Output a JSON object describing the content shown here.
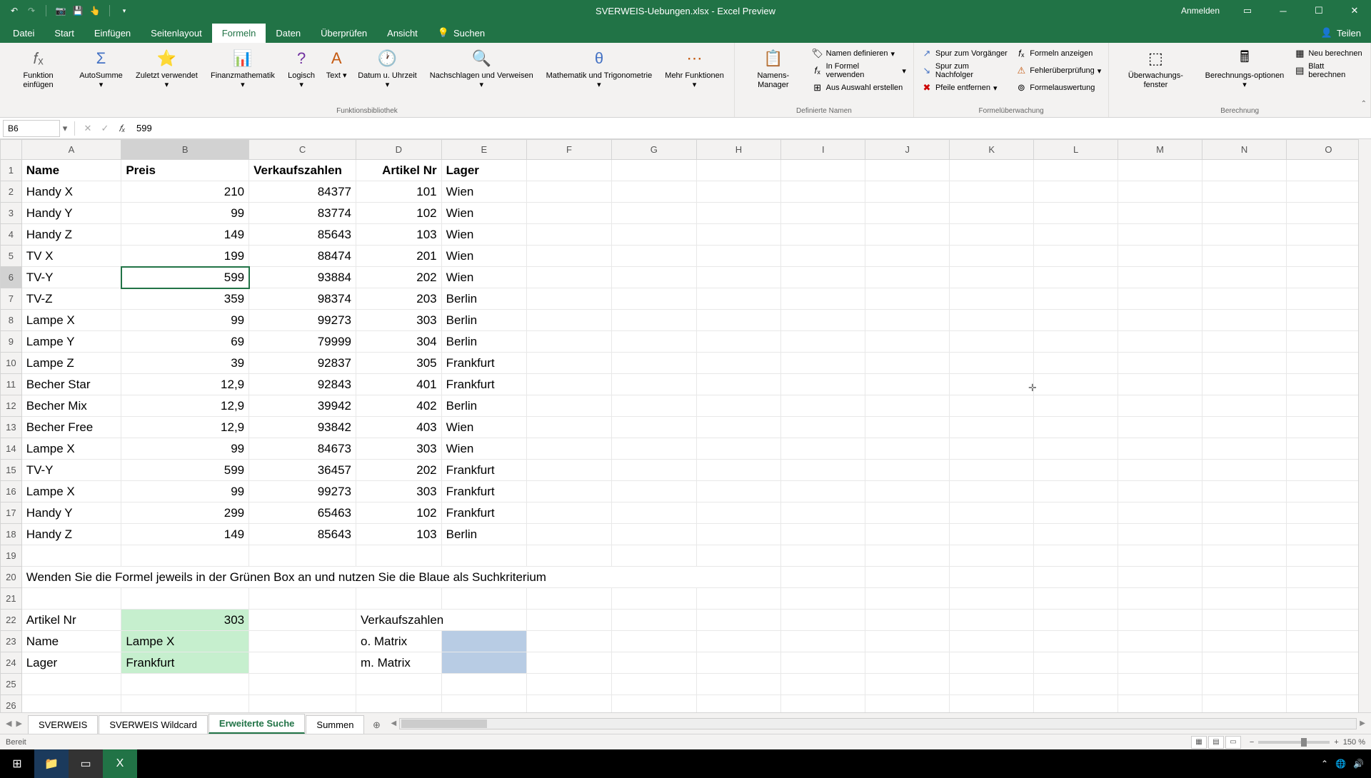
{
  "titlebar": {
    "filename": "SVERWEIS-Uebungen.xlsx",
    "app": "Excel Preview",
    "login": "Anmelden"
  },
  "tabs": {
    "file": "Datei",
    "home": "Start",
    "insert": "Einfügen",
    "layout": "Seitenlayout",
    "formulas": "Formeln",
    "data": "Daten",
    "review": "Überprüfen",
    "view": "Ansicht",
    "search": "Suchen",
    "share": "Teilen"
  },
  "ribbon": {
    "insert_fn": "Funktion einfügen",
    "autosum": "AutoSumme",
    "recent": "Zuletzt verwendet",
    "financial": "Finanzmathematik",
    "logical": "Logisch",
    "text": "Text",
    "datetime": "Datum u. Uhrzeit",
    "lookup": "Nachschlagen und Verweisen",
    "math": "Mathematik und Trigonometrie",
    "more": "Mehr Funktionen",
    "group1": "Funktionsbibliothek",
    "name_mgr": "Namens-Manager",
    "def_name": "Namen definieren",
    "use_formula": "In Formel verwenden",
    "from_sel": "Aus Auswahl erstellen",
    "group2": "Definierte Namen",
    "trace_prec": "Spur zum Vorgänger",
    "trace_dep": "Spur zum Nachfolger",
    "remove_arrows": "Pfeile entfernen",
    "show_formulas": "Formeln anzeigen",
    "error_check": "Fehlerüberprüfung",
    "eval_formula": "Formelauswertung",
    "group3": "Formelüberwachung",
    "watch": "Überwachungs-fenster",
    "calc_opts": "Berechnungs-optionen",
    "calc_now": "Neu berechnen",
    "calc_sheet": "Blatt berechnen",
    "group4": "Berechnung"
  },
  "formula_bar": {
    "cell_ref": "B6",
    "value": "599"
  },
  "columns": [
    "A",
    "B",
    "C",
    "D",
    "E",
    "F",
    "G",
    "H",
    "I",
    "J",
    "K",
    "L",
    "M",
    "N",
    "O"
  ],
  "headers": {
    "name": "Name",
    "preis": "Preis",
    "verkauf": "Verkaufszahlen",
    "artikel": "Artikel Nr",
    "lager": "Lager"
  },
  "rows": [
    {
      "name": "Handy X",
      "preis": "210",
      "verkauf": "84377",
      "artikel": "101",
      "lager": "Wien"
    },
    {
      "name": "Handy Y",
      "preis": "99",
      "verkauf": "83774",
      "artikel": "102",
      "lager": "Wien"
    },
    {
      "name": "Handy Z",
      "preis": "149",
      "verkauf": "85643",
      "artikel": "103",
      "lager": "Wien"
    },
    {
      "name": "TV X",
      "preis": "199",
      "verkauf": "88474",
      "artikel": "201",
      "lager": "Wien"
    },
    {
      "name": "TV-Y",
      "preis": "599",
      "verkauf": "93884",
      "artikel": "202",
      "lager": "Wien"
    },
    {
      "name": "TV-Z",
      "preis": "359",
      "verkauf": "98374",
      "artikel": "203",
      "lager": "Berlin"
    },
    {
      "name": "Lampe X",
      "preis": "99",
      "verkauf": "99273",
      "artikel": "303",
      "lager": "Berlin"
    },
    {
      "name": "Lampe Y",
      "preis": "69",
      "verkauf": "79999",
      "artikel": "304",
      "lager": "Berlin"
    },
    {
      "name": "Lampe Z",
      "preis": "39",
      "verkauf": "92837",
      "artikel": "305",
      "lager": "Frankfurt"
    },
    {
      "name": "Becher Star",
      "preis": "12,9",
      "verkauf": "92843",
      "artikel": "401",
      "lager": "Frankfurt"
    },
    {
      "name": "Becher Mix",
      "preis": "12,9",
      "verkauf": "39942",
      "artikel": "402",
      "lager": "Berlin"
    },
    {
      "name": "Becher Free",
      "preis": "12,9",
      "verkauf": "93842",
      "artikel": "403",
      "lager": "Wien"
    },
    {
      "name": "Lampe X",
      "preis": "99",
      "verkauf": "84673",
      "artikel": "303",
      "lager": "Wien"
    },
    {
      "name": "TV-Y",
      "preis": "599",
      "verkauf": "36457",
      "artikel": "202",
      "lager": "Frankfurt"
    },
    {
      "name": "Lampe X",
      "preis": "99",
      "verkauf": "99273",
      "artikel": "303",
      "lager": "Frankfurt"
    },
    {
      "name": "Handy Y",
      "preis": "299",
      "verkauf": "65463",
      "artikel": "102",
      "lager": "Frankfurt"
    },
    {
      "name": "Handy Z",
      "preis": "149",
      "verkauf": "85643",
      "artikel": "103",
      "lager": "Berlin"
    }
  ],
  "instruction": "Wenden Sie die Formel jeweils in der Grünen Box an und nutzen Sie die Blaue als Suchkriterium",
  "lookup": {
    "artikel_lbl": "Artikel Nr",
    "artikel_val": "303",
    "name_lbl": "Name",
    "name_val": "Lampe X",
    "lager_lbl": "Lager",
    "lager_val": "Frankfurt",
    "verkauf_lbl": "Verkaufszahlen",
    "omatrix": "o. Matrix",
    "mmatrix": "m. Matrix"
  },
  "sheets": {
    "s1": "SVERWEIS",
    "s2": "SVERWEIS Wildcard",
    "s3": "Erweiterte Suche",
    "s4": "Summen"
  },
  "status": {
    "ready": "Bereit",
    "zoom": "150 %"
  }
}
